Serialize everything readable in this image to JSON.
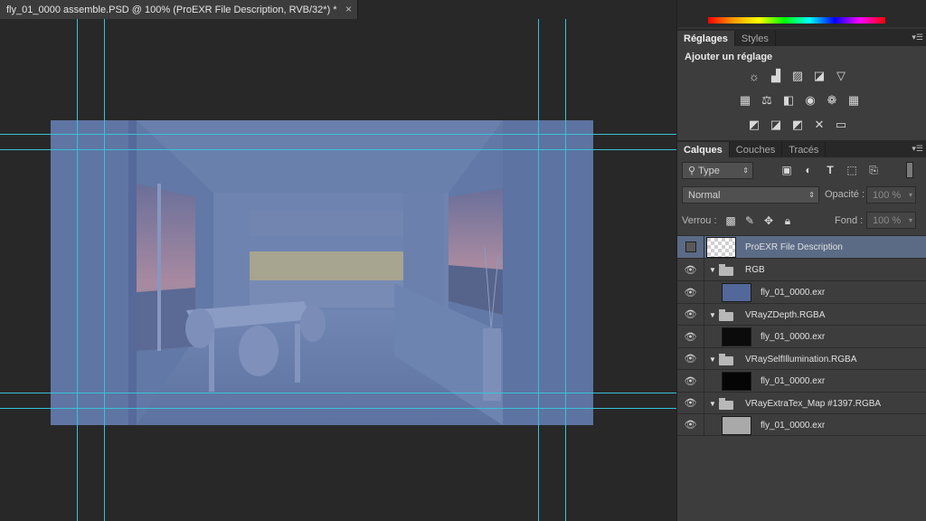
{
  "document": {
    "tab_title": "fly_01_0000 assemble.PSD @ 100% (ProEXR File Description, RVB/32*) *",
    "close_glyph": "×"
  },
  "adjustments": {
    "tabs": [
      "Réglages",
      "Styles"
    ],
    "title": "Ajouter un réglage",
    "icons_row1": [
      "brightness-icon",
      "levels-icon",
      "curves-icon",
      "exposure-icon",
      "vibrance-icon"
    ],
    "icons_row2": [
      "hue-saturation-icon",
      "color-balance-icon",
      "black-white-icon",
      "photo-filter-icon",
      "channel-mixer-icon",
      "color-lookup-icon"
    ],
    "icons_row3": [
      "invert-icon",
      "posterize-icon",
      "threshold-icon",
      "selective-color-icon",
      "gradient-map-icon"
    ]
  },
  "layers": {
    "tabs": [
      "Calques",
      "Couches",
      "Tracés"
    ],
    "filter_kind": "Type",
    "blend_mode": "Normal",
    "opacity_label": "Opacité :",
    "opacity_value": "100 %",
    "lock_label": "Verrou :",
    "fill_label": "Fond :",
    "fill_value": "100 %",
    "rows": [
      {
        "name": "ProEXR File Description",
        "type": "layer",
        "visible": false,
        "selected": true,
        "thumb": "transparent"
      },
      {
        "name": "RGB",
        "type": "group",
        "visible": true
      },
      {
        "name": "fly_01_0000.exr",
        "type": "layer",
        "visible": true,
        "thumb": "blue"
      },
      {
        "name": "VRayZDepth.RGBA",
        "type": "group",
        "visible": true
      },
      {
        "name": "fly_01_0000.exr",
        "type": "layer",
        "visible": true,
        "thumb": "black"
      },
      {
        "name": "VRaySelfIllumination.RGBA",
        "type": "group",
        "visible": true
      },
      {
        "name": "fly_01_0000.exr",
        "type": "layer",
        "visible": true,
        "thumb": "black"
      },
      {
        "name": "VRayExtraTex_Map #1397.RGBA",
        "type": "group",
        "visible": true
      },
      {
        "name": "fly_01_0000.exr",
        "type": "layer",
        "visible": true,
        "thumb": "grey"
      }
    ]
  },
  "colors": {
    "selection": "#5b6b86",
    "guide": "#38c2d8",
    "canvas_tint": "#5e74a2"
  }
}
